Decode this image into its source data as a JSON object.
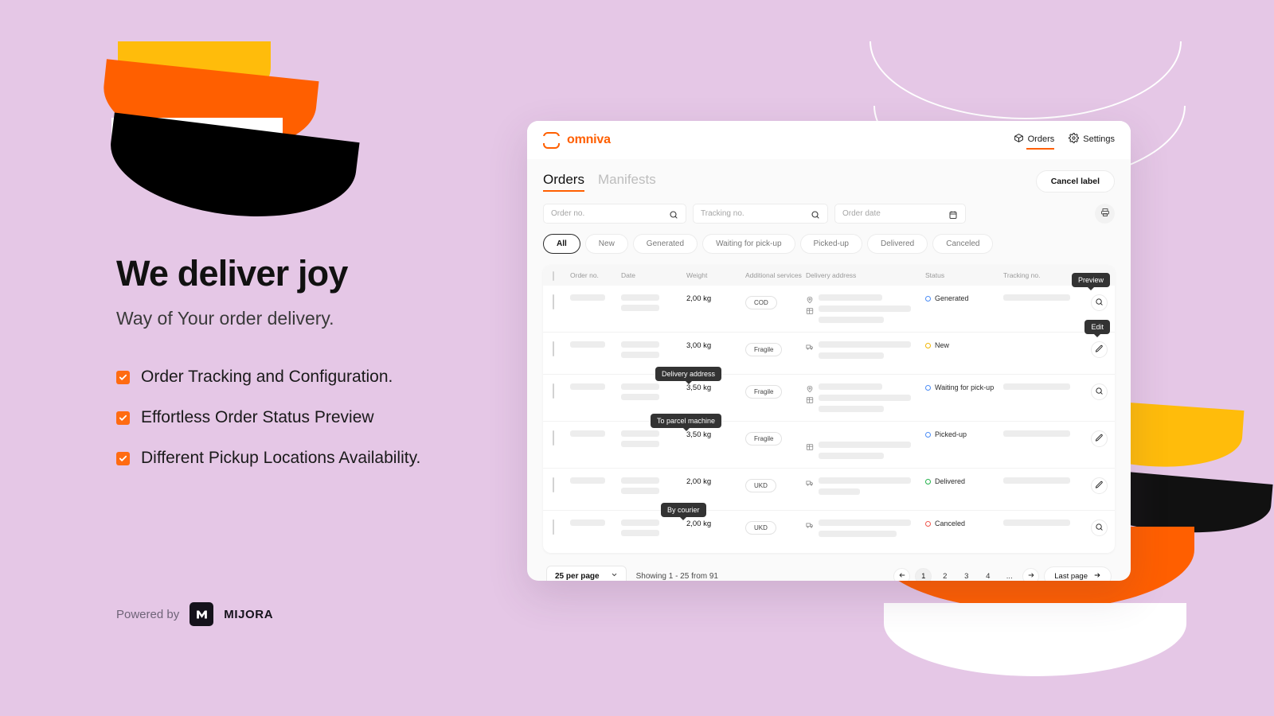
{
  "marketing": {
    "headline": "We deliver joy",
    "subhead": "Way of Your order delivery.",
    "features": [
      "Order Tracking and Configuration.",
      "Effortless Order Status Preview",
      "Different Pickup Locations Availability."
    ],
    "powered_by_label": "Powered by",
    "partner_name": "MIJORA",
    "partner_mark": "M"
  },
  "colors": {
    "background": "#e5c7e6",
    "brand_orange": "#FF5F00",
    "accent_yellow": "#FFBC0B",
    "check_orange": "#FF6B12",
    "status_blue": "#4C8DF6",
    "status_yellow": "#F2B705",
    "status_green": "#24B24C",
    "status_red": "#F0584F"
  },
  "app": {
    "brand_name": "omniva",
    "header_nav": [
      {
        "label": "Orders",
        "icon": "box-icon",
        "active": true
      },
      {
        "label": "Settings",
        "icon": "gear-icon",
        "active": false
      }
    ],
    "tabs": [
      {
        "label": "Orders",
        "active": true
      },
      {
        "label": "Manifests",
        "active": false
      }
    ],
    "cancel_label_button": "Cancel label",
    "search": {
      "order_no_placeholder": "Order no.",
      "order_no_value": "",
      "tracking_no_placeholder": "Tracking no.",
      "tracking_no_value": "",
      "order_date_placeholder": "Order date",
      "order_date_value": "",
      "print_icon": "printer-icon"
    },
    "filters": [
      {
        "label": "All",
        "active": true
      },
      {
        "label": "New",
        "active": false
      },
      {
        "label": "Generated",
        "active": false
      },
      {
        "label": "Waiting for pick-up",
        "active": false
      },
      {
        "label": "Picked-up",
        "active": false
      },
      {
        "label": "Delivered",
        "active": false
      },
      {
        "label": "Canceled",
        "active": false
      }
    ],
    "table": {
      "columns": [
        "Order no.",
        "Date",
        "Weight",
        "Additional services",
        "Delivery address",
        "Status",
        "Tracking no."
      ],
      "rows": [
        {
          "checked": false,
          "weight": "2,00 kg",
          "service": "COD",
          "address_icons": [
            "pin-icon",
            "parcel-machine-icon"
          ],
          "status": "Generated",
          "status_color": "#4C8DF6",
          "action": "preview",
          "action_icon": "search-icon"
        },
        {
          "checked": false,
          "weight": "3,00 kg",
          "service": "Fragile",
          "address_icons": [
            "courier-truck-icon"
          ],
          "status": "New",
          "status_color": "#F2B705",
          "action": "edit",
          "action_icon": "pencil-icon"
        },
        {
          "checked": false,
          "weight": "3,50 kg",
          "service": "Fragile",
          "address_icons": [
            "pin-icon",
            "parcel-machine-icon"
          ],
          "status": "Waiting for pick-up",
          "status_color": "#4C8DF6",
          "action": "preview",
          "action_icon": "search-icon"
        },
        {
          "checked": false,
          "weight": "3,50 kg",
          "service": "Fragile",
          "address_icons": [
            "pin-icon",
            "parcel-machine-icon"
          ],
          "status": "Picked-up",
          "status_color": "#4C8DF6",
          "action": "edit",
          "action_icon": "pencil-icon"
        },
        {
          "checked": false,
          "weight": "2,00 kg",
          "service": "UKD",
          "address_icons": [
            "courier-truck-icon"
          ],
          "status": "Delivered",
          "status_color": "#24B24C",
          "action": "edit",
          "action_icon": "pencil-icon"
        },
        {
          "checked": true,
          "weight": "2,00 kg",
          "service": "UKD",
          "address_icons": [
            "courier-truck-icon"
          ],
          "status": "Canceled",
          "status_color": "#F0584F",
          "action": "preview",
          "action_icon": "search-icon"
        }
      ]
    },
    "tooltips": {
      "preview": "Preview",
      "edit": "Edit",
      "delivery_address": "Delivery address",
      "to_parcel_machine": "To parcel machine",
      "by_courier": "By courier"
    },
    "footer": {
      "per_page": "25 per page",
      "showing": "Showing 1 - 25 from 91",
      "pages": [
        "1",
        "2",
        "3",
        "4",
        "..."
      ],
      "current_page": "1",
      "last_page_label": "Last page"
    }
  }
}
